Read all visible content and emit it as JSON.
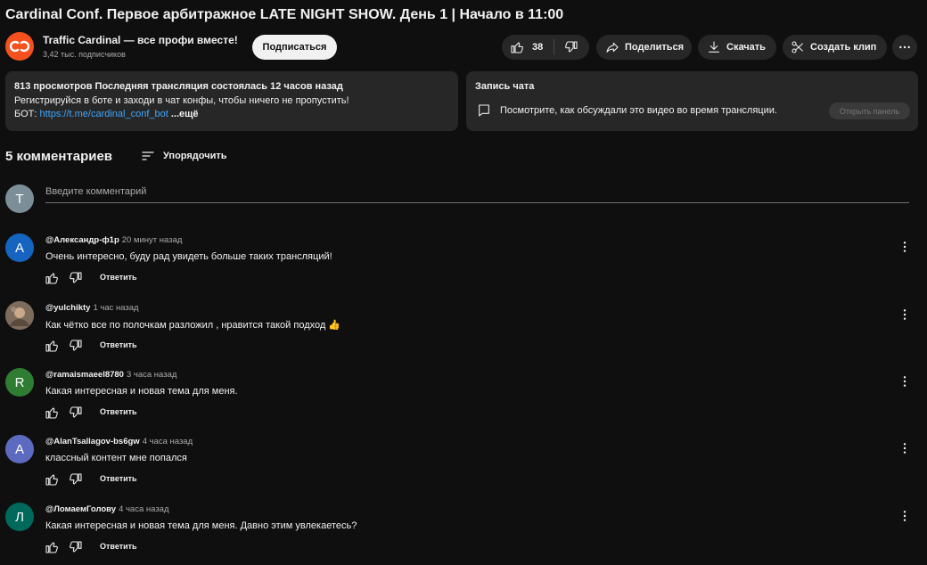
{
  "video": {
    "title": "Cardinal Conf. Первое арбитражное LATE NIGHT SHOW. День 1 | Начало в 11:00"
  },
  "channel": {
    "name": "Traffic Cardinal — все профи вместе!",
    "subscribers": "3,42 тыс. подписчиков",
    "subscribe_label": "Подписаться",
    "avatar_color": "#f4511e"
  },
  "actions": {
    "like_count": "38",
    "share_label": "Поделиться",
    "download_label": "Скачать",
    "clip_label": "Создать клип"
  },
  "description": {
    "meta": "813 просмотров  Последняя трансляция состоялась 12 часов назад",
    "line1": "Регистрируйся в боте и заходи в чат конфы, чтобы ничего не пропустить!",
    "bot_prefix": "БОТ: ",
    "bot_link": "https://t.me/cardinal_conf_bot",
    "more_label": "...ещё"
  },
  "chat_replay": {
    "title": "Запись чата",
    "text": "Посмотрите, как обсуждали это видео во время трансляции.",
    "open_label": "Открыть панель"
  },
  "comments": {
    "count_label": "5 комментариев",
    "sort_label": "Упорядочить",
    "input_placeholder": "Введите комментарий",
    "current_user_initial": "T",
    "reply_label": "Ответить",
    "items": [
      {
        "author": "@Александр-ф1р",
        "time": "20 минут назад",
        "text": "Очень интересно, буду рад увидеть больше таких трансляций!",
        "initial": "А",
        "avatar_color": "#1565c0"
      },
      {
        "author": "@yulchikty",
        "time": "1 час назад",
        "text": "Как чётко все по полочкам разложил , нравится такой подход 👍",
        "initial": "",
        "avatar_color": "#8d7b6a"
      },
      {
        "author": "@ramaismaeel8780",
        "time": "3 часа назад",
        "text": "Какая интересная и новая тема для меня.",
        "initial": "R",
        "avatar_color": "#2e7d32"
      },
      {
        "author": "@AlanTsallagov-bs6gw",
        "time": "4 часа назад",
        "text": "классный контент мне попался",
        "initial": "A",
        "avatar_color": "#5c6bc0"
      },
      {
        "author": "@ЛомаемГолову",
        "time": "4 часа назад",
        "text": "Какая интересная и новая тема для меня. Давно этим увлекаетесь?",
        "initial": "Л",
        "avatar_color": "#00695c"
      }
    ]
  }
}
